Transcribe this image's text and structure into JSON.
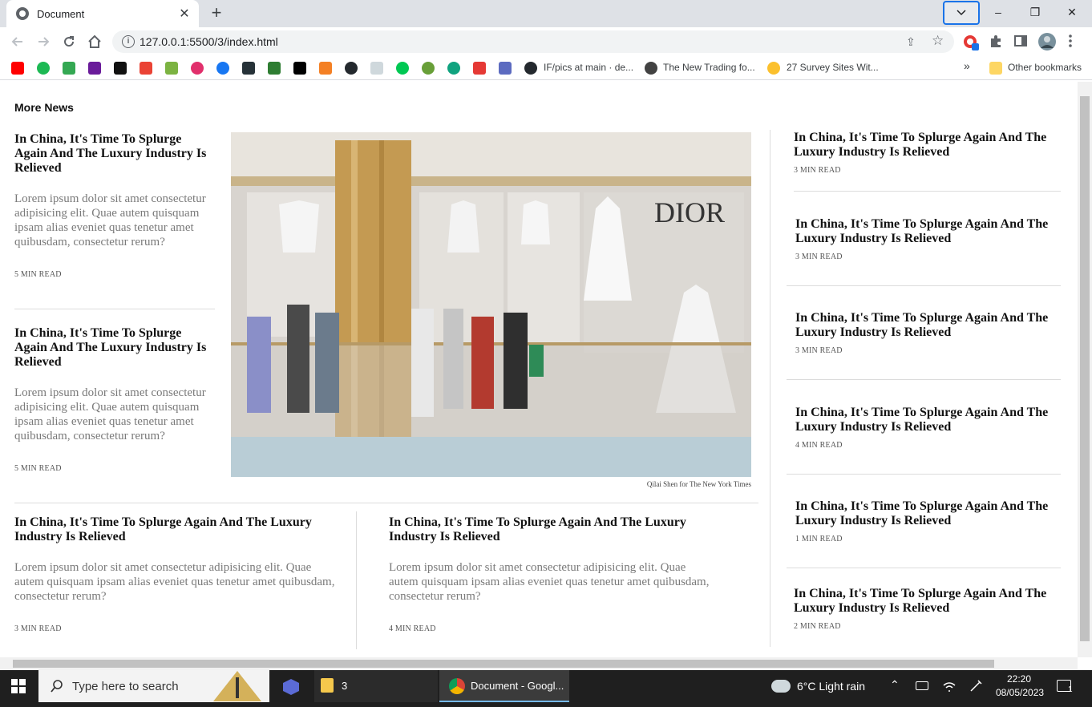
{
  "browser": {
    "tab_title": "Document",
    "new_tab": "+",
    "url": "127.0.0.1:5500/3/index.html",
    "window_controls": {
      "minimize": "–",
      "restore": "❐",
      "close": "✕"
    }
  },
  "bookmarks": [
    {
      "label": "IF/pics at main · de..."
    },
    {
      "label": "The New Trading fo..."
    },
    {
      "label": "27 Survey Sites Wit..."
    }
  ],
  "bookmarks_overflow": "»",
  "other_bookmarks": "Other bookmarks",
  "page": {
    "section_title": "More News",
    "left_stories": [
      {
        "headline": "In China, It's Time To Splurge Again And The Luxury Industry Is Relieved",
        "summary": "Lorem ipsum dolor sit amet consectetur adipisicing elit. Quae autem quisquam ipsam alias eveniet quas tenetur amet quibusdam, consectetur rerum?",
        "read_time": "5 MIN READ"
      },
      {
        "headline": "In China, It's Time To Splurge Again And The Luxury Industry Is Relieved",
        "summary": "Lorem ipsum dolor sit amet consectetur adipisicing elit. Quae autem quisquam ipsam alias eveniet quas tenetur amet quibusdam, consectetur rerum?",
        "read_time": "5 MIN READ"
      }
    ],
    "hero": {
      "brand_sign": "DIOR",
      "caption": "Qilai Shen for The New York Times"
    },
    "bottom_stories": [
      {
        "headline": "In China, It's Time To Splurge Again And The Luxury Industry Is Relieved",
        "summary": "Lorem ipsum dolor sit amet consectetur adipisicing elit. Quae autem quisquam ipsam alias eveniet quas tenetur amet quibusdam, consectetur rerum?",
        "read_time": "3 MIN READ"
      },
      {
        "headline": "In China, It's Time To Splurge Again And The Luxury Industry Is Relieved",
        "summary": "Lorem ipsum dolor sit amet consectetur adipisicing elit. Quae autem quisquam ipsam alias eveniet quas tenetur amet quibusdam, consectetur rerum?",
        "read_time": "4 MIN READ"
      }
    ],
    "right_stories": [
      {
        "headline": "In China, It's Time To Splurge Again And The Luxury Industry Is Relieved",
        "read_time": "3 MIN READ"
      },
      {
        "headline": "In China, It's Time To Splurge Again And The Luxury Industry Is Relieved",
        "read_time": "3 MIN READ"
      },
      {
        "headline": "In China, It's Time To Splurge Again And The Luxury Industry Is Relieved",
        "read_time": "3 MIN READ"
      },
      {
        "headline": "In China, It's Time To Splurge Again And The Luxury Industry Is Relieved",
        "read_time": "4 MIN READ"
      },
      {
        "headline": "In China, It's Time To Splurge Again And The Luxury Industry Is Relieved",
        "read_time": "1 MIN READ"
      },
      {
        "headline": "In China, It's Time To Splurge Again And The Luxury Industry Is Relieved",
        "read_time": "2 MIN READ"
      }
    ]
  },
  "taskbar": {
    "search_placeholder": "Type here to search",
    "explorer_count": "3",
    "chrome_label": "Document - Googl...",
    "weather": "6°C  Light rain",
    "time": "22:20",
    "date": "08/05/2023",
    "notification_count": "1"
  },
  "colors": {
    "tab_strip": "#dee1e6",
    "accent": "#1a73e8",
    "taskbar": "#1f1f1f"
  }
}
